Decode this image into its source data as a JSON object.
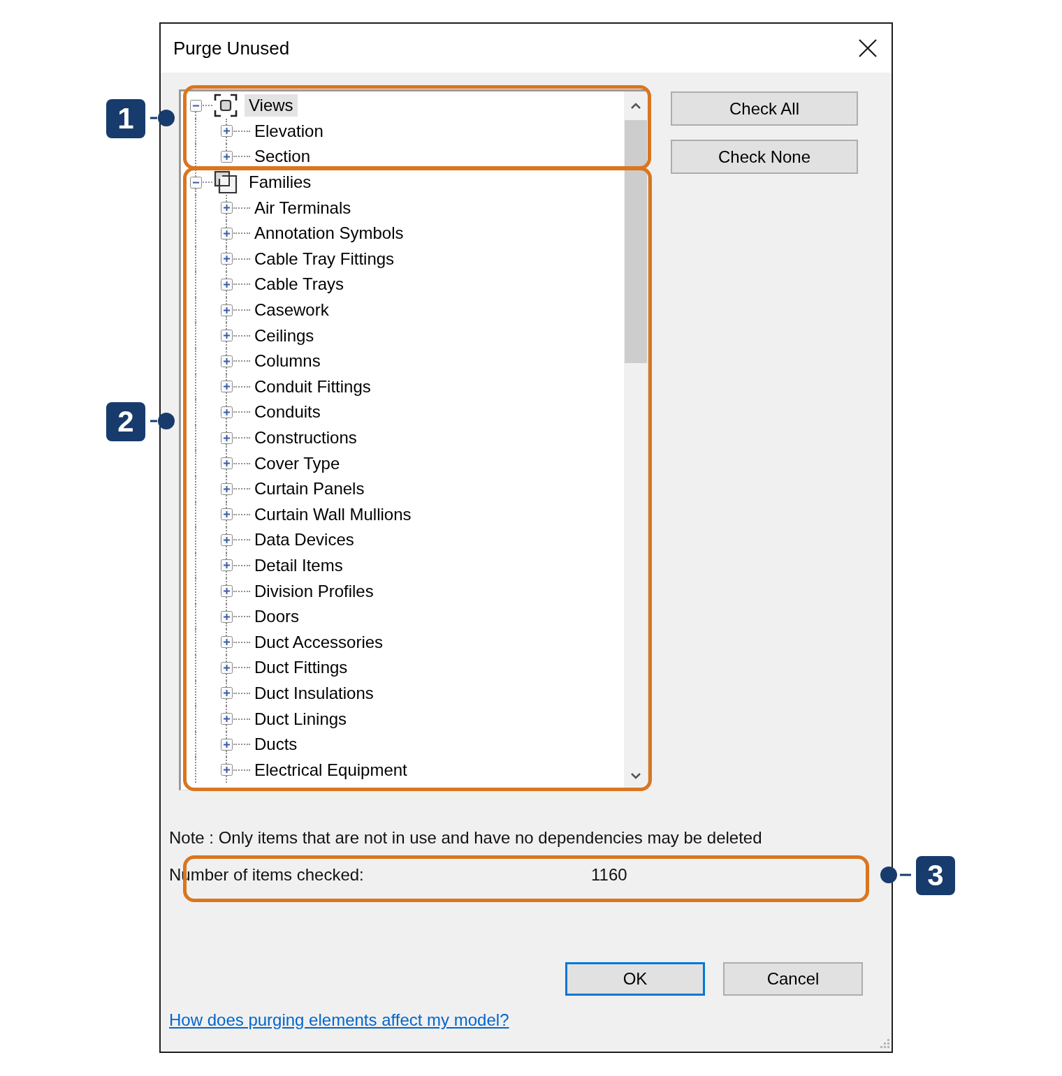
{
  "dialog": {
    "title": "Purge Unused"
  },
  "tree": [
    {
      "label": "Views",
      "kind": "views",
      "expanded": true,
      "selected": true,
      "children": [
        {
          "label": "Elevation",
          "expanded": false,
          "selected": false
        },
        {
          "label": "Section",
          "expanded": false,
          "selected": false
        }
      ]
    },
    {
      "label": "Families",
      "kind": "families",
      "expanded": true,
      "selected": false,
      "children": [
        {
          "label": "Air Terminals",
          "expanded": false,
          "selected": false
        },
        {
          "label": "Annotation Symbols",
          "expanded": false,
          "selected": false
        },
        {
          "label": "Cable Tray Fittings",
          "expanded": false,
          "selected": false
        },
        {
          "label": "Cable Trays",
          "expanded": false,
          "selected": false
        },
        {
          "label": "Casework",
          "expanded": false,
          "selected": false
        },
        {
          "label": "Ceilings",
          "expanded": false,
          "selected": false
        },
        {
          "label": "Columns",
          "expanded": false,
          "selected": false
        },
        {
          "label": "Conduit Fittings",
          "expanded": false,
          "selected": false
        },
        {
          "label": "Conduits",
          "expanded": false,
          "selected": false
        },
        {
          "label": "Constructions",
          "expanded": false,
          "selected": false
        },
        {
          "label": "Cover Type",
          "expanded": false,
          "selected": false
        },
        {
          "label": "Curtain Panels",
          "expanded": false,
          "selected": false
        },
        {
          "label": "Curtain Wall Mullions",
          "expanded": false,
          "selected": false
        },
        {
          "label": "Data Devices",
          "expanded": false,
          "selected": false
        },
        {
          "label": "Detail Items",
          "expanded": false,
          "selected": false
        },
        {
          "label": "Division Profiles",
          "expanded": false,
          "selected": false
        },
        {
          "label": "Doors",
          "expanded": false,
          "selected": false
        },
        {
          "label": "Duct Accessories",
          "expanded": false,
          "selected": false
        },
        {
          "label": "Duct Fittings",
          "expanded": false,
          "selected": false
        },
        {
          "label": "Duct Insulations",
          "expanded": false,
          "selected": false
        },
        {
          "label": "Duct Linings",
          "expanded": false,
          "selected": false
        },
        {
          "label": "Ducts",
          "expanded": false,
          "selected": false
        },
        {
          "label": "Electrical Equipment",
          "expanded": false,
          "selected": false
        }
      ]
    }
  ],
  "side_buttons": [
    "Check All",
    "Check None"
  ],
  "note": "Note : Only items that are not in use and have no dependencies may be deleted",
  "count": {
    "label": "Number of items checked:",
    "value": "1160"
  },
  "buttons": [
    {
      "label": "OK",
      "default": true
    },
    {
      "label": "Cancel",
      "default": false
    }
  ],
  "help_link": "How does purging elements affect my model?",
  "callouts": [
    {
      "number": "1"
    },
    {
      "number": "2"
    },
    {
      "number": "3"
    }
  ]
}
